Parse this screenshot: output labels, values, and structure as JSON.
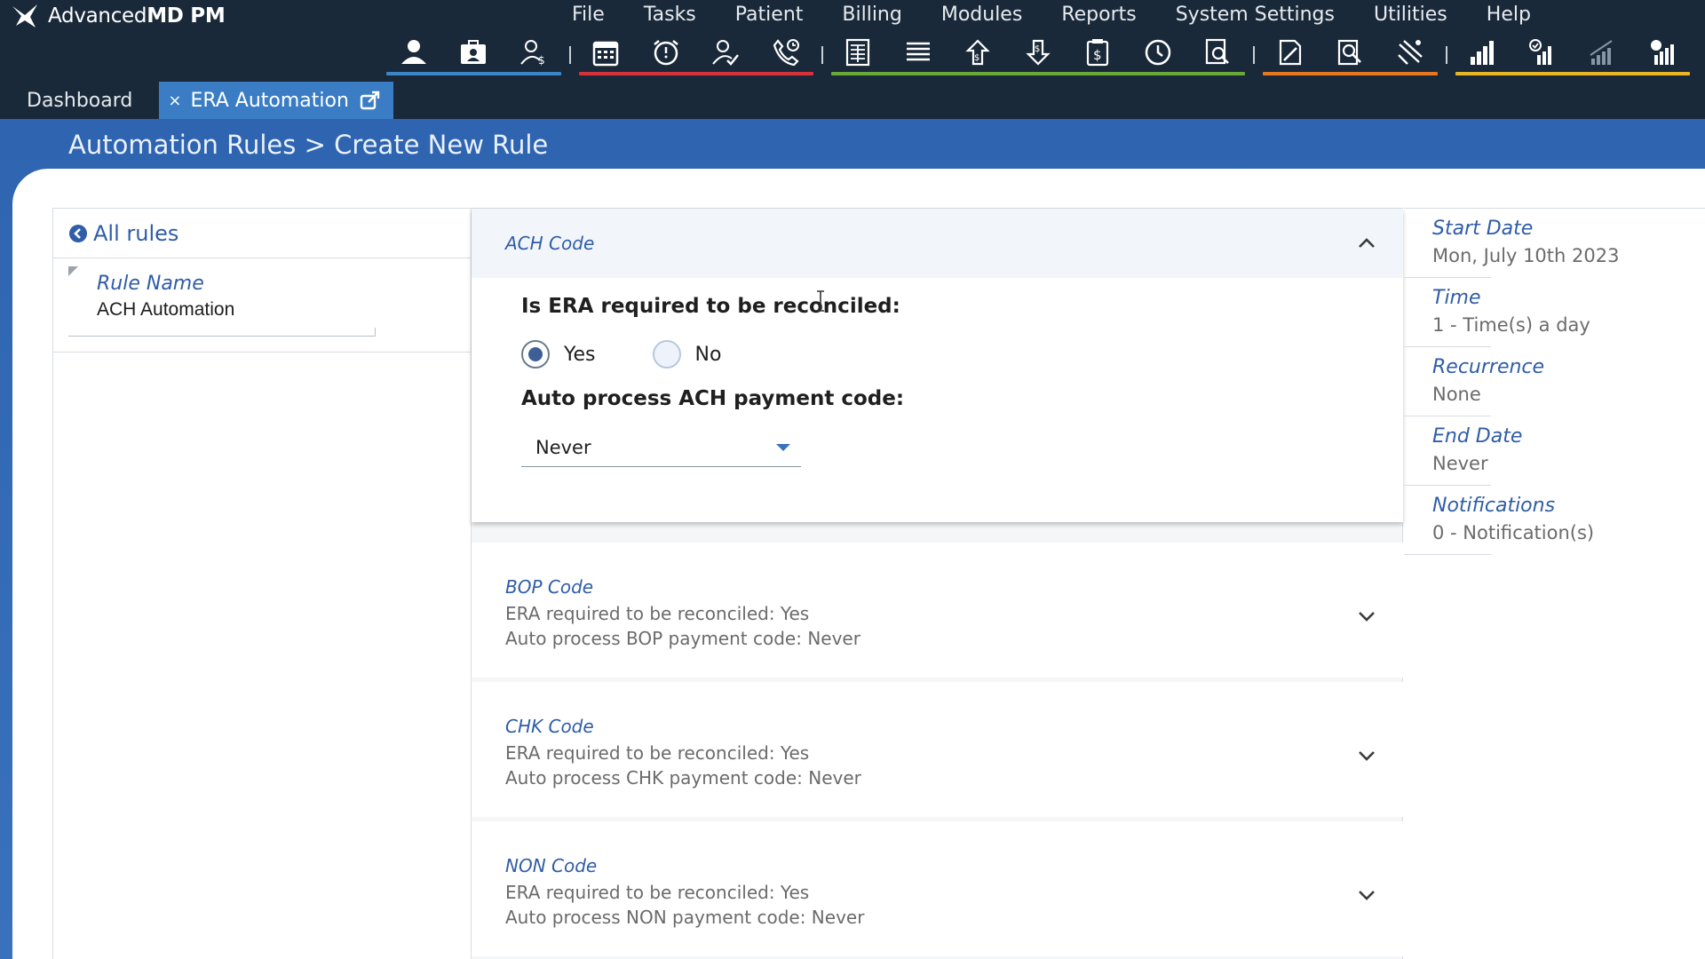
{
  "app": {
    "brand_name": "Advanced",
    "brand_bold": "MD PM"
  },
  "menu": [
    {
      "label": "File"
    },
    {
      "label": "Tasks"
    },
    {
      "label": "Patient"
    },
    {
      "label": "Billing"
    },
    {
      "label": "Modules"
    },
    {
      "label": "Reports"
    },
    {
      "label": "System Settings"
    },
    {
      "label": "Utilities"
    },
    {
      "label": "Help"
    }
  ],
  "toolbar_colors": {
    "blue": "#3a86c8",
    "red": "#d6323a",
    "green": "#6aa837",
    "orange": "#e87722",
    "yellow": "#eab626"
  },
  "tabs": [
    {
      "label": "Dashboard",
      "active": false
    },
    {
      "label": "ERA Automation",
      "active": true,
      "close": "×"
    }
  ],
  "breadcrumb": "Automation Rules > Create New Rule",
  "left": {
    "back_label": "All rules",
    "rule_name_label": "Rule Name",
    "rule_name_value": "ACH Automation"
  },
  "ach": {
    "title": "ACH Code",
    "question_reconcile": "Is ERA required to be reconciled:",
    "yes_label": "Yes",
    "no_label": "No",
    "selected": "Yes",
    "question_auto": "Auto process ACH payment code:",
    "auto_value": "Never"
  },
  "codes": [
    {
      "title": "BOP Code",
      "line1": "ERA required to be reconciled: Yes",
      "line2": "Auto process BOP payment code: Never"
    },
    {
      "title": "CHK Code",
      "line1": "ERA required to be reconciled: Yes",
      "line2": "Auto process CHK payment code: Never"
    },
    {
      "title": "NON Code",
      "line1": "ERA required to be reconciled: Yes",
      "line2": "Auto process NON payment code: Never"
    }
  ],
  "schedule": [
    {
      "label": "Start Date",
      "value": "Mon, July 10th 2023"
    },
    {
      "label": "Time",
      "value": "1 - Time(s) a day"
    },
    {
      "label": "Recurrence",
      "value": "None"
    },
    {
      "label": "End Date",
      "value": "Never"
    },
    {
      "label": "Notifications",
      "value": "0 - Notification(s)"
    }
  ]
}
